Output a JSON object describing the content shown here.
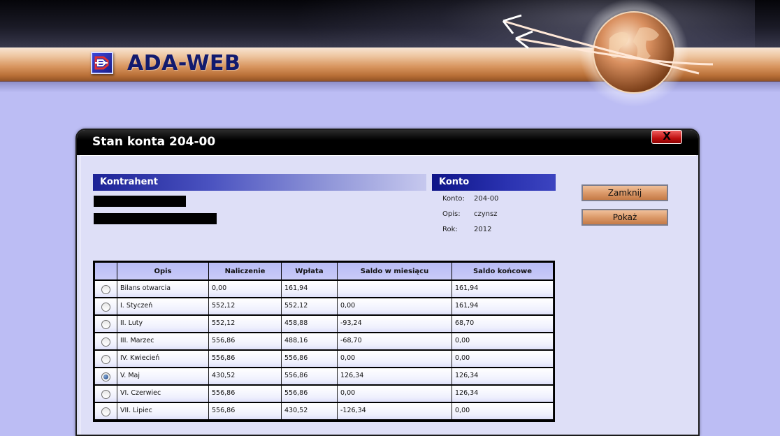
{
  "app": {
    "title": "ADA-WEB"
  },
  "window": {
    "title": "Stan konta 204-00",
    "close_label": "X"
  },
  "kontrahent": {
    "heading": "Kontrahent"
  },
  "konto": {
    "heading": "Konto",
    "fields": [
      {
        "label": "Konto:",
        "value": "204-00"
      },
      {
        "label": "Opis:",
        "value": "czynsz"
      },
      {
        "label": "Rok:",
        "value": "2012"
      }
    ]
  },
  "buttons": {
    "close": "Zamknij",
    "show": "Pokaż"
  },
  "table": {
    "headers": [
      "",
      "Opis",
      "Naliczenie",
      "Wpłata",
      "Saldo w miesiącu",
      "Saldo końcowe"
    ],
    "rows": [
      {
        "selected": false,
        "opis": "Bilans otwarcia",
        "naliczenie": "0,00",
        "wplata": "161,94",
        "saldo_mies": "",
        "saldo_konc": "161,94"
      },
      {
        "selected": false,
        "opis": "I. Styczeń",
        "naliczenie": "552,12",
        "wplata": "552,12",
        "saldo_mies": "0,00",
        "saldo_konc": "161,94"
      },
      {
        "selected": false,
        "opis": "II. Luty",
        "naliczenie": "552,12",
        "wplata": "458,88",
        "saldo_mies": "-93,24",
        "saldo_konc": "68,70"
      },
      {
        "selected": false,
        "opis": "III. Marzec",
        "naliczenie": "556,86",
        "wplata": "488,16",
        "saldo_mies": "-68,70",
        "saldo_konc": "0,00"
      },
      {
        "selected": false,
        "opis": "IV. Kwiecień",
        "naliczenie": "556,86",
        "wplata": "556,86",
        "saldo_mies": "0,00",
        "saldo_konc": "0,00"
      },
      {
        "selected": true,
        "opis": "V. Maj",
        "naliczenie": "430,52",
        "wplata": "556,86",
        "saldo_mies": "126,34",
        "saldo_konc": "126,34"
      },
      {
        "selected": false,
        "opis": "VI. Czerwiec",
        "naliczenie": "556,86",
        "wplata": "556,86",
        "saldo_mies": "0,00",
        "saldo_konc": "126,34"
      },
      {
        "selected": false,
        "opis": "VII. Lipiec",
        "naliczenie": "556,86",
        "wplata": "430,52",
        "saldo_mies": "-126,34",
        "saldo_konc": "0,00"
      }
    ]
  }
}
